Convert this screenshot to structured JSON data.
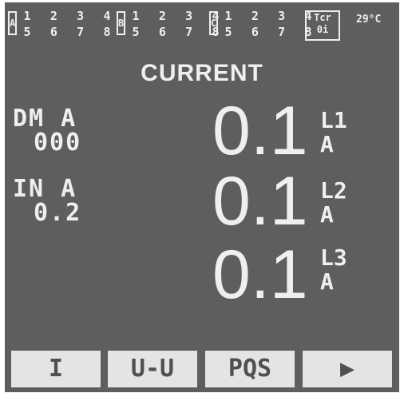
{
  "status_bar": {
    "groups": [
      {
        "letter": "A",
        "row1": [
          "1",
          "2",
          "3",
          "4"
        ],
        "row2": [
          "5",
          "6",
          "7",
          "8"
        ]
      },
      {
        "letter": "B",
        "row1": [
          "1",
          "2",
          "3",
          "4"
        ],
        "row2": [
          "5",
          "6",
          "7",
          "8"
        ]
      },
      {
        "letter": "C",
        "row1": [
          "1",
          "2",
          "3",
          "4"
        ],
        "row2": [
          "5",
          "6",
          "7",
          "8"
        ]
      }
    ],
    "tcr_line1": "Tcr",
    "tcr_line2": "0i",
    "temperature": "29°C"
  },
  "title": "CURRENT",
  "left_panel": {
    "dm_label": "DM A",
    "dm_value": "000",
    "in_label": "IN A",
    "in_value": "0.2"
  },
  "phases": [
    {
      "value": "0.1",
      "line": "L1",
      "unit": "A"
    },
    {
      "value": "0.1",
      "line": "L2",
      "unit": "A"
    },
    {
      "value": "0.1",
      "line": "L3",
      "unit": "A"
    }
  ],
  "softkeys": [
    "I",
    "U-U",
    "PQS",
    "▶"
  ],
  "colors": {
    "screen_bg": "#5e5e5e",
    "text": "#efefef",
    "key_bg": "#e4e4e4",
    "key_text": "#505050"
  }
}
